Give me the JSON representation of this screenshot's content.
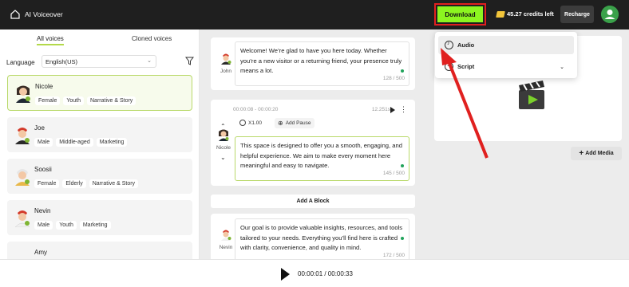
{
  "header": {
    "app_title": "AI Voiceover",
    "download_label": "Download",
    "credits": "45.27 credits left",
    "recharge_label": "Recharge"
  },
  "left": {
    "tabs": [
      "All voices",
      "Cloned voices"
    ],
    "language_label": "Language",
    "language_value": "English(US)",
    "voices": [
      {
        "name": "Nicole",
        "tags": [
          "Female",
          "Youth",
          "Narrative & Story"
        ]
      },
      {
        "name": "Joe",
        "tags": [
          "Male",
          "Middle-aged",
          "Marketing"
        ]
      },
      {
        "name": "Soosii",
        "tags": [
          "Female",
          "Elderly",
          "Narrative & Story"
        ]
      },
      {
        "name": "Nevin",
        "tags": [
          "Male",
          "Youth",
          "Marketing"
        ]
      },
      {
        "name": "Amy",
        "tags": []
      }
    ]
  },
  "blocks": [
    {
      "speaker": "John",
      "text": "Welcome! We’re glad to have you here today. Whether you’re a new visitor or a returning friend, your presence truly means a lot.",
      "count": "128 / 500"
    },
    {
      "speaker": "Nicole",
      "timecode": "00:00:08 - 00:00:20",
      "duration": "12.251s",
      "speed": "X1.00",
      "add_pause": "Add Pause",
      "text": "This space is designed to offer you a smooth, engaging, and helpful experience. We aim to make every moment here meaningful and easy to navigate.",
      "count": "145 / 500"
    },
    {
      "speaker": "Nevin",
      "text": "Our goal is to provide valuable insights, resources, and tools tailored to your needs. Everything you’ll find here is crafted with clarity, convenience, and quality in mind.",
      "count": "172 / 500"
    }
  ],
  "add_block_label": "Add A Block",
  "add_media_label": "Add Media",
  "menu": {
    "items": [
      "Audio",
      "Script"
    ]
  },
  "player": {
    "time": "00:00:01 / 00:00:33"
  },
  "colors": {
    "accent": "#8cf520",
    "highlight_border": "#e0201f",
    "selected_border": "#b9d96a"
  }
}
